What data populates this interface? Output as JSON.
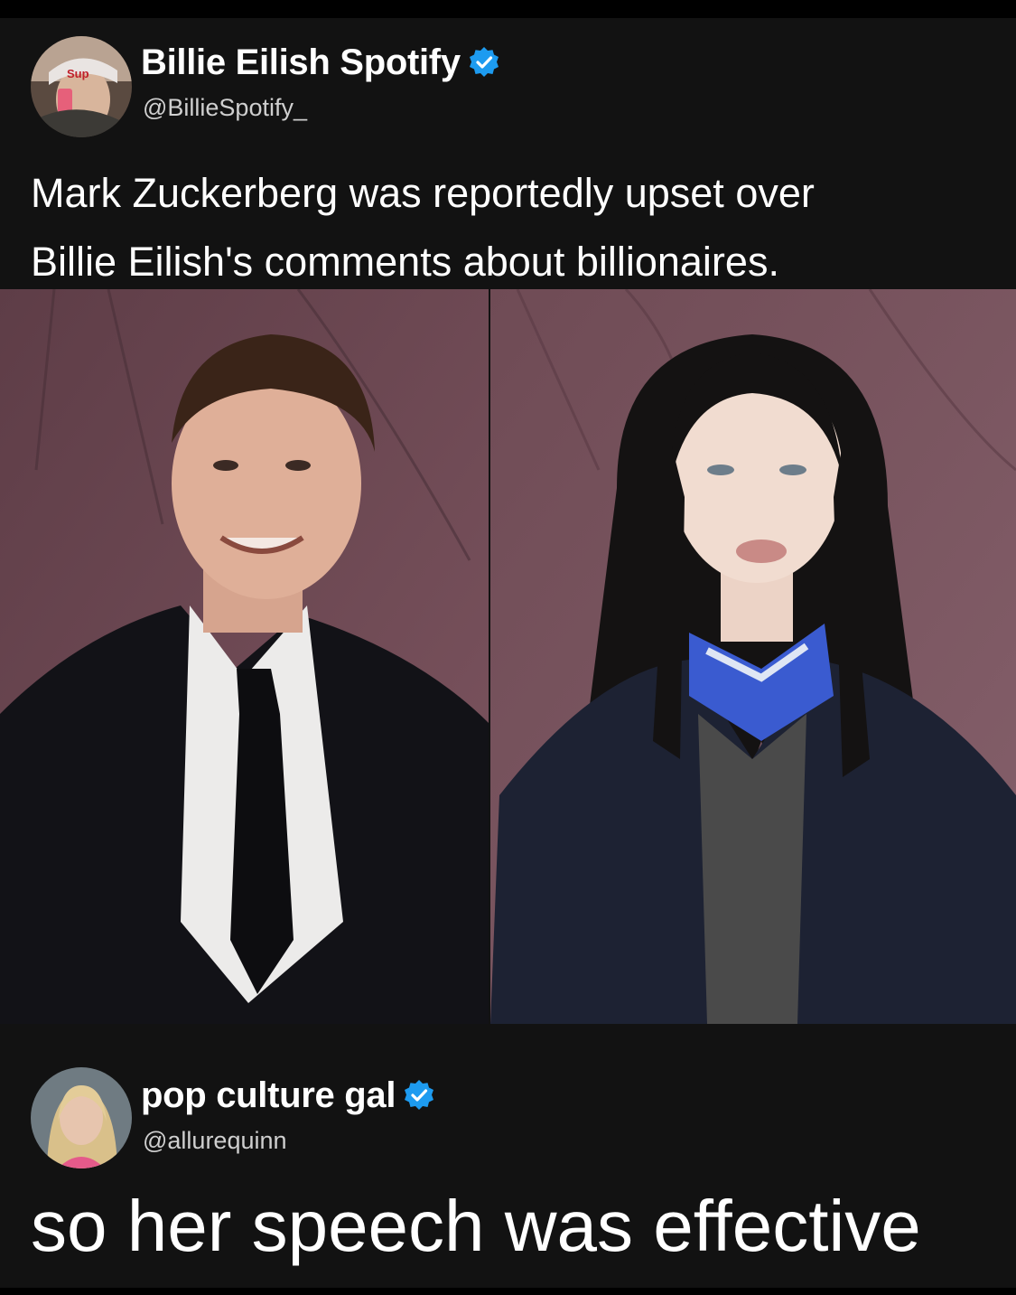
{
  "posts": [
    {
      "author": "Billie Eilish Spotify",
      "handle": "@BillieSpotify_",
      "verified": true,
      "text_lines": [
        "Mark Zuckerberg was reportedly upset over",
        "Billie Eilish's comments about billionaires."
      ]
    },
    {
      "author": "pop culture gal",
      "handle": "@allurequinn",
      "verified": true,
      "text_lines": [
        "so her speech was effective"
      ]
    }
  ],
  "colors": {
    "background": "#000000",
    "card": "#121212",
    "verified_badge": "#1d9bf0",
    "backdrop": "#6e4a54"
  },
  "icons": {
    "verified": "verified-check-icon"
  }
}
